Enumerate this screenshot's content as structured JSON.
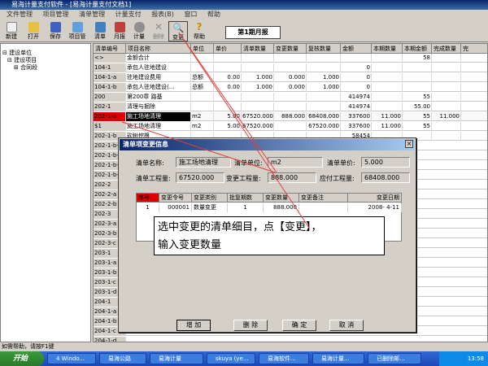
{
  "window": {
    "title": "易海计量支付软件 - [易海计量支付文档1]"
  },
  "menu": [
    "文件管理",
    "项目管理",
    "清单管理",
    "计量支付",
    "报表(B)",
    "窗口",
    "帮助"
  ],
  "toolbar": {
    "items": [
      {
        "label": "新建",
        "icon": "new-file-icon",
        "color": "#f0f0f0"
      },
      {
        "label": "打开",
        "icon": "folder-icon",
        "color": "#e8c040"
      },
      {
        "label": "保存",
        "icon": "save-icon",
        "color": "#4060c0"
      },
      {
        "label": "项目管",
        "icon": "project-icon",
        "color": "#60a0e0"
      },
      {
        "label": "清单",
        "icon": "list-icon",
        "color": "#4080c0"
      },
      {
        "label": "月报",
        "icon": "monthly-report-icon",
        "color": "#c04040"
      },
      {
        "label": "计量",
        "icon": "measure-icon",
        "color": "#808080"
      },
      {
        "label": "删除",
        "icon": "delete-icon",
        "color": "#c0c0c0"
      },
      {
        "label": "变更",
        "icon": "change-icon",
        "color": "#404040"
      },
      {
        "label": "帮助",
        "icon": "help-icon",
        "color": "#f0c000"
      }
    ],
    "period": "第1期月报"
  },
  "tree": {
    "items": [
      "建设单位",
      "建设项目",
      "合同段"
    ]
  },
  "grid": {
    "headers": [
      "清单编号",
      "项目名称",
      "单位",
      "单价",
      "清单数量",
      "变更数量",
      "复核数量",
      "金额",
      "本期数量",
      "本期金额",
      "完成数量",
      "完"
    ],
    "rows": [
      {
        "id": "<>",
        "name": "金额合计",
        "unit": "",
        "price": "",
        "qty": "",
        "change": "",
        "review": "",
        "amount": "",
        "cur_qty": "",
        "cur_amt": "58",
        "done": ""
      },
      {
        "id": "104-1",
        "name": "承包人驻地建设",
        "unit": "",
        "price": "",
        "qty": "",
        "change": "",
        "review": "",
        "amount": "0",
        "cur_qty": "",
        "cur_amt": "",
        "done": ""
      },
      {
        "id": "104-1-a",
        "name": "驻地建设费用",
        "unit": "总额",
        "price": "0.00",
        "qty": "1.000",
        "change": "0.000",
        "review": "1.000",
        "amount": "0",
        "cur_qty": "",
        "cur_amt": "",
        "done": ""
      },
      {
        "id": "104-1-b",
        "name": "承包人驻地建设(...",
        "unit": "总额",
        "price": "0.00",
        "qty": "1.000",
        "change": "0.000",
        "review": "1.000",
        "amount": "0",
        "cur_qty": "",
        "cur_amt": "",
        "done": ""
      },
      {
        "id": "200",
        "name": "第200章 路基",
        "unit": "",
        "price": "",
        "qty": "",
        "change": "",
        "review": "",
        "amount": "414974",
        "cur_qty": "",
        "cur_amt": "55",
        "done": ""
      },
      {
        "id": "202-1",
        "name": "清理与掘除",
        "unit": "",
        "price": "",
        "qty": "",
        "change": "",
        "review": "",
        "amount": "414974",
        "cur_qty": "",
        "cur_amt": "55.00",
        "done": ""
      },
      {
        "id": "202-1-a",
        "name": "施工场地清理",
        "unit": "m2",
        "price": "5.00",
        "qty": "67520.000",
        "change": "888.000",
        "review": "68408.000",
        "amount": "337600",
        "cur_qty": "11.000",
        "cur_amt": "55",
        "done": "11.000"
      },
      {
        "id": "$1",
        "name": "施工场地清理",
        "unit": "m2",
        "price": "5.00",
        "qty": "67520.000",
        "change": "",
        "review": "67520.000",
        "amount": "337600",
        "cur_qty": "11.000",
        "cur_amt": "55",
        "done": ""
      },
      {
        "id": "202-1-b",
        "name": "砍树挖根",
        "unit": "",
        "price": "",
        "qty": "",
        "change": "",
        "review": "",
        "amount": "58454",
        "cur_qty": "",
        "cur_amt": "",
        "done": ""
      }
    ],
    "more_ids": [
      "202-1-b-1",
      "202-1-b-2",
      "202-1-b-3",
      "202-1-b-4",
      "202-2",
      "202-2-a",
      "202-2-b",
      "202-3",
      "202-3-a",
      "202-3-b",
      "202-3-c",
      "203-1",
      "203-1-a",
      "203-1-b",
      "203-1-c",
      "203-1-d",
      "204-1",
      "204-1-a",
      "204-1-b",
      "204-1-c",
      "204-1-d"
    ]
  },
  "dialog": {
    "title": "清单项变更信息",
    "fields": {
      "name_label": "清单名称:",
      "name_value": "施工场地清理",
      "unit_label": "清单单位:",
      "unit_value": "m2",
      "price_label": "清单单价:",
      "price_value": "5.000",
      "qty_label": "清单工程量:",
      "qty_value": "67520.000",
      "change_label": "变更工程量:",
      "change_value": "888.000",
      "due_label": "应付工程量:",
      "due_value": "68408.000"
    },
    "table": {
      "headers": [
        "序号",
        "变更令号",
        "变更类别",
        "批复期数",
        "变更数量",
        "变更备注",
        "变更日期"
      ],
      "row": [
        "1",
        "000001",
        "数量变更",
        "1",
        "888.000",
        "",
        "2008- 4-11"
      ]
    },
    "callout_line1": "选中变更的清单细目，点【变更】，",
    "callout_line2": "输入变更数量",
    "buttons": {
      "add": "增  加",
      "delete": "删  除",
      "ok": "确  定",
      "cancel": "取  消"
    }
  },
  "status": "如需帮助，请按F1键",
  "taskbar": {
    "start": "开始",
    "tasks": [
      "4 Windo...",
      "易海公路",
      "易海计量",
      "skuya (ye...",
      "易海软件...",
      "易海计量...",
      "已删除邮..."
    ],
    "clock": "13:58"
  }
}
